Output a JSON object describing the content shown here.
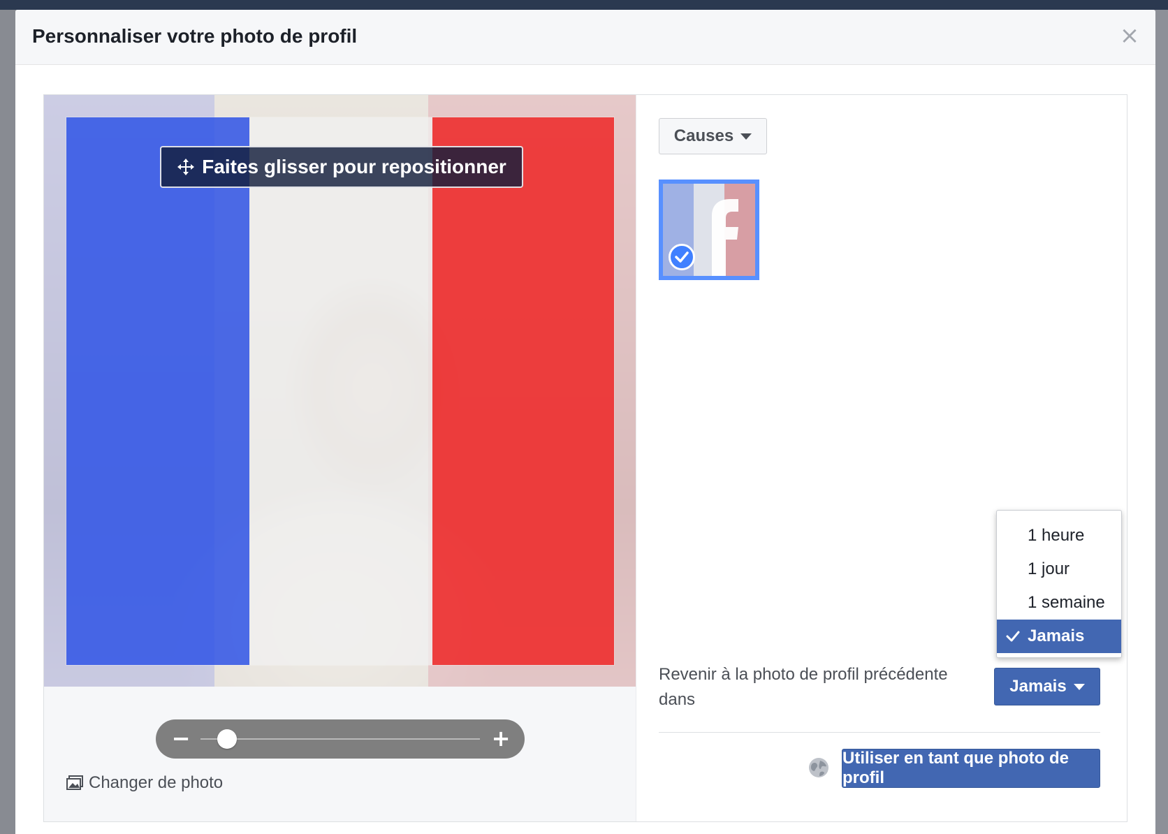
{
  "dialog": {
    "title": "Personnaliser votre photo de profil",
    "close_symbol": "×"
  },
  "editor": {
    "reposition_label": "Faites glisser pour repositionner",
    "zoom_minus": "−",
    "zoom_plus": "+",
    "zoom_level": 0.06,
    "change_photo_label": "Changer de photo",
    "overlay_colors": {
      "blue": "#2f54e6",
      "white": "#f1f1f1",
      "red": "#ee2a2a"
    }
  },
  "sidebar": {
    "category_label": "Causes",
    "revert_label": "Revenir à la photo de profil précédente dans",
    "revert_selected": "Jamais",
    "use_button_label": "Utiliser en tant que photo de profil"
  },
  "revert_menu": {
    "options": [
      {
        "label": "1 heure",
        "selected": false
      },
      {
        "label": "1 jour",
        "selected": false
      },
      {
        "label": "1 semaine",
        "selected": false
      },
      {
        "label": "Jamais",
        "selected": true
      }
    ]
  },
  "colors": {
    "accent": "#4267b2",
    "selection_border": "#5890ff",
    "header_bg": "#f6f7f9"
  }
}
